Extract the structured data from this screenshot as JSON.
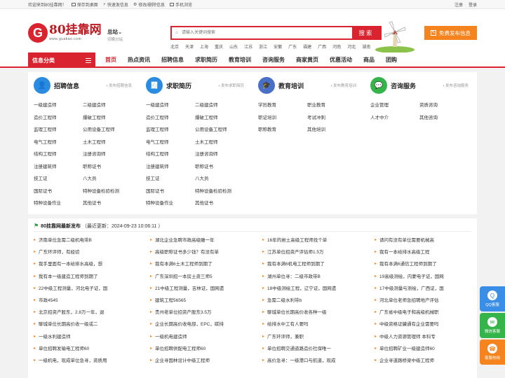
{
  "topbar": {
    "welcome": "欢迎来到80挂靠网！",
    "save_desktop": "保存到桌面",
    "quick_publish": "快速发信息",
    "edit_delete": "修改/删除信息",
    "mobile": "手机浏览",
    "register": "注册",
    "login": "登录"
  },
  "header": {
    "logo_text": "80挂靠网",
    "logo_url": "www.guakao.com",
    "city_name": "总站",
    "city_switch": "切换分站",
    "search_placeholder": "请输入关键词搜索",
    "search_button": "搜索",
    "hot_cities": [
      "北京",
      "天津",
      "上海",
      "重庆",
      "山东",
      "江苏",
      "浙江",
      "安徽",
      "广东",
      "福建",
      "广西",
      "河南",
      "河北",
      "湖南"
    ],
    "post_button": "免费发布信息"
  },
  "nav": {
    "category_label": "信息分类",
    "items": [
      "首页",
      "热点资讯",
      "招聘信息",
      "求职简历",
      "教育培训",
      "咨询服务",
      "商家黄页",
      "优惠活动",
      "商品",
      "团购"
    ]
  },
  "categories": [
    {
      "title": "招聘信息",
      "post": "发布招聘信息",
      "color": "#2b8be0",
      "items": [
        "一级建造师",
        "二级建造师",
        "造价工程师",
        "爆破工程师",
        "监理工程师",
        "公用设备工程师",
        "电气工程师",
        "土木工程师",
        "结构工程师",
        "注册咨询师",
        "注册建筑师",
        "职称证书",
        "技工证",
        "八大员",
        "国际证书",
        "特种设备检验检测",
        "特种设备作业",
        "其他证书"
      ]
    },
    {
      "title": "求职简历",
      "post": "发布求职简历",
      "color": "#2b8be0",
      "items": [
        "一级建造师",
        "二级建造师",
        "造价工程师",
        "爆破工程师",
        "监理工程师",
        "公用设备工程师",
        "电气工程师",
        "土木工程师",
        "结构工程师",
        "注册咨询师",
        "注册建筑师",
        "职称证书",
        "技工证",
        "八大员",
        "国际证书",
        "特种设备检验检测",
        "特种设备作业",
        "其他证书"
      ]
    },
    {
      "title": "教育培训",
      "post": "发布教育培训",
      "color": "#4a6fc7",
      "items": [
        "学历教育",
        "职业教育",
        "职证培训",
        "考试冲刺",
        "职称教育",
        "其他培训"
      ]
    },
    {
      "title": "咨询服务",
      "post": "发布咨询服务",
      "color": "#35b44a",
      "items": [
        "企业管理",
        "资质咨询",
        "人才中介",
        "其他咨询"
      ]
    }
  ],
  "news": {
    "title": "80挂靠网最新发布",
    "updated": "（最近更新：2024-09-23 10:06:11 ）",
    "columns": [
      [
        {
          "t": "济南单位急需二级机电带B"
        },
        {
          "t": "广东环评师，有经验"
        },
        {
          "t": "我手里面有一本给排水高级，想"
        },
        {
          "t": "我有本一级建造工程师到期了"
        },
        {
          "t": "22中级工程测量，河北电子证，国"
        },
        {
          "t": "市政4545"
        },
        {
          "t": "北京招资产股东，2.8万一年，退"
        },
        {
          "t": "聊城单位长期高价收一级或二"
        },
        {
          "t": "一级水利建造师"
        },
        {
          "t": "单位招聘发输电工程师60"
        },
        {
          "t": "一级机电，现成单位急寻，资质用"
        }
      ],
      [
        {
          "t": "湖北企业急聘市政高级雕一年"
        },
        {
          "t": "高级职称证书多少钱？有没有单"
        },
        {
          "t": "我有本满6土木工程师到期了"
        },
        {
          "t": "广东深圳招一本房土资三师5"
        },
        {
          "t": "21中级工程测量，吉林证，国网遗"
        },
        {
          "t": "建筑工程56565"
        },
        {
          "t": "贵州老单位招资产股东3.5万"
        },
        {
          "t": "企业长期高价收电部，EPC，碳排"
        },
        {
          "t": "一级机电建造师"
        },
        {
          "t": "单位招聘供配电工程师60"
        },
        {
          "t": "企业寻国林设计中级工程师"
        }
      ],
      [
        {
          "t": "16年的岩土高级工程师找个单"
        },
        {
          "t": "江苏单位招资产评估师1.5万"
        },
        {
          "t": "我有本满6机电工程师到期了"
        },
        {
          "t": "湖州单位寻：二级市政带B"
        },
        {
          "t": "18中级测绘工程，辽宁证，国网遗"
        },
        {
          "t": "急需二级水利带b"
        },
        {
          "t": "聊城单位长期高价收各种一级"
        },
        {
          "t": "给排水中工有人要吗"
        },
        {
          "t": "广东环评师，兼职"
        },
        {
          "t": "单位招聘交通道路造价社保唯一"
        },
        {
          "t": "高价急寻：一级港口与航道，现成"
        }
      ],
      [
        {
          "t": "请问有没有单位需要机械高"
        },
        {
          "t": "我有一本给排水高级工程"
        },
        {
          "t": "我有本满6通信工程师到期了"
        },
        {
          "t": "19高级测绘，内蒙电子证，国网"
        },
        {
          "t": "17中级测量与测绘，广西证，国"
        },
        {
          "t": "河北单位老师急招聘地产评估"
        },
        {
          "t": "广东省中级电子和高级机械职"
        },
        {
          "t": "中级资格证罐通有企业需要吗"
        },
        {
          "t": "中级人力资源管理师 本科专"
        },
        {
          "t": "单位招聘矿业一级建造师60"
        },
        {
          "t": "企业寻道路桥梁中级工程师"
        }
      ]
    ]
  },
  "side": {
    "qq": "QQ客服",
    "wechat": "微信客服",
    "phone": "客服热线"
  }
}
